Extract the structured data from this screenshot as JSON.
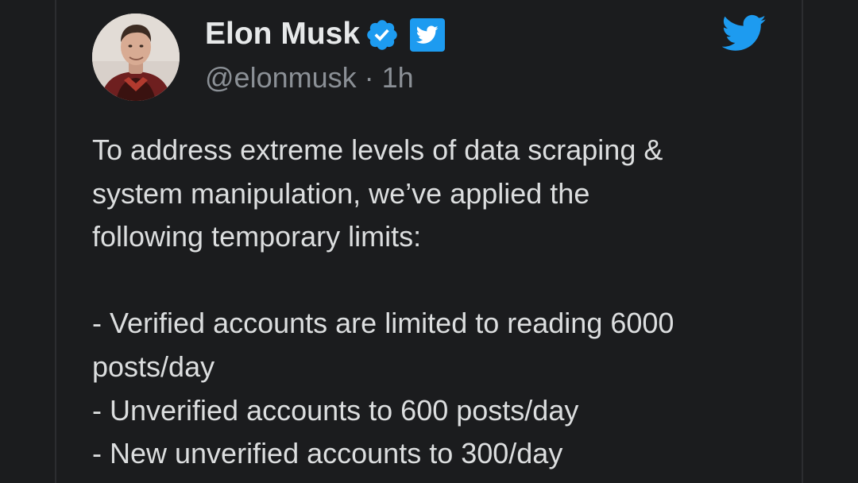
{
  "author": {
    "name": "Elon Musk",
    "handle": "@elonmusk",
    "separator": "·",
    "time": "1h",
    "avatar_icon": "profile-photo",
    "verified_icon": "verified-badge-icon",
    "badge_icon": "twitter-bird-badge-icon"
  },
  "logo_icon": "twitter-logo-icon",
  "colors": {
    "background": "#1b1c1e",
    "text": "#dcdedf",
    "muted": "#8b9096",
    "accent": "#1d9bf0"
  },
  "tweet": {
    "lines": [
      "To address extreme levels of data scraping &",
      "system manipulation, we’ve applied the",
      "following temporary limits:",
      "",
      "- Verified accounts are limited to reading 6000",
      "posts/day",
      "- Unverified accounts to 600 posts/day",
      "- New unverified accounts to 300/day"
    ]
  }
}
